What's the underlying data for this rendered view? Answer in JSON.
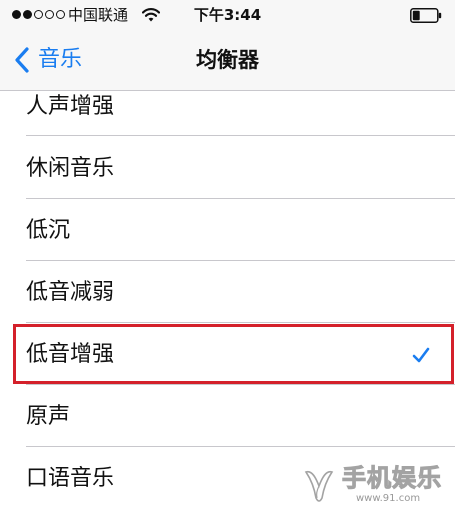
{
  "status_bar": {
    "signal_dots": [
      true,
      true,
      false,
      false,
      false
    ],
    "carrier": "中国联通",
    "wifi_icon": "wifi-icon",
    "time": "下午3:44",
    "battery_icon": "battery-icon",
    "battery_level": 0.3
  },
  "nav": {
    "back_icon": "chevron-left-icon",
    "back_label": "音乐",
    "title": "均衡器"
  },
  "equalizer_list": {
    "items": [
      {
        "label": "人声增强",
        "selected": false
      },
      {
        "label": "休闲音乐",
        "selected": false
      },
      {
        "label": "低沉",
        "selected": false
      },
      {
        "label": "低音减弱",
        "selected": false
      },
      {
        "label": "低音增强",
        "selected": true
      },
      {
        "label": "原声",
        "selected": false
      },
      {
        "label": "口语音乐",
        "selected": false
      }
    ],
    "check_icon": "checkmark-icon"
  },
  "annotation": {
    "highlight_color": "#d4202a"
  },
  "watermark": {
    "text": "手机娱乐",
    "url": "www.91.com"
  },
  "colors": {
    "accent": "#1a7df0",
    "separator": "#c8c7cc"
  }
}
